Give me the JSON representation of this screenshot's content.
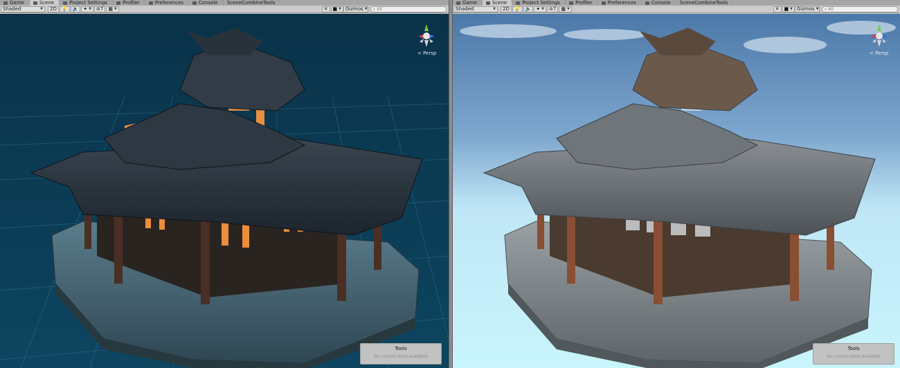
{
  "tabs": [
    {
      "label": "Game"
    },
    {
      "label": "Scene"
    },
    {
      "label": "Project Settings"
    },
    {
      "label": "Profiler"
    },
    {
      "label": "Preferences"
    },
    {
      "label": "Console"
    },
    {
      "label": "SceneCombineTools"
    }
  ],
  "toolbar": {
    "shading_mode": "Shaded",
    "mode_2d": "2D",
    "hidden_count": "7",
    "gizmos_label": "Gizmos",
    "search_placeholder": "All"
  },
  "viewport": {
    "projection_label": "< Persp"
  },
  "tools_panel": {
    "title": "Tools",
    "message": "No custom tools available"
  },
  "colors": {
    "left_sky": "#0b3a52",
    "right_sky_top": "#4f7aaa",
    "right_sky_bottom": "#bff0fb",
    "window_glow": "#ff9a40"
  }
}
